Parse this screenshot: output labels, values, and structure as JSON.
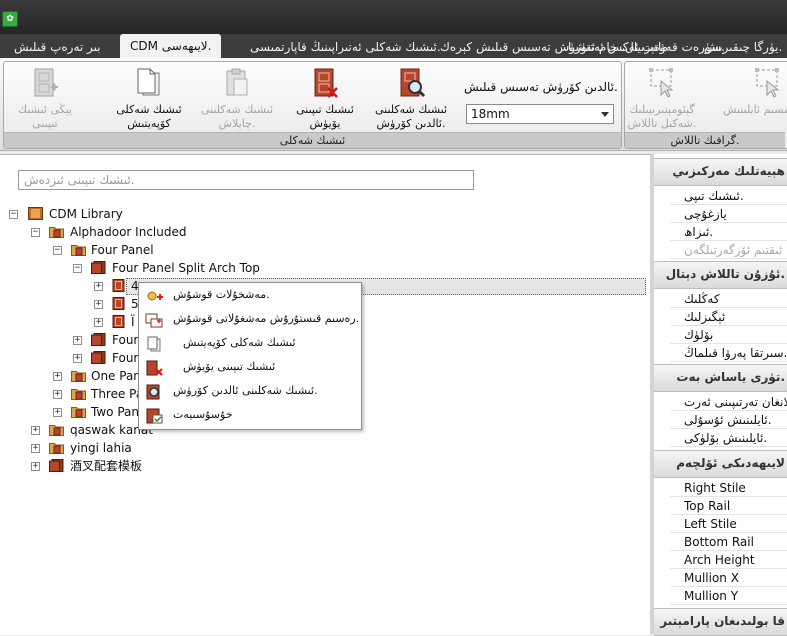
{
  "tabs": [
    {
      "label": "بىر تەرەپ قىلىش"
    },
    {
      "label": "CDM لايىھەسى."
    },
    {
      "label": "ئىشىك شەكلى ئەتىراپىنىڭ قاپارتمىسى."
    },
    {
      "label": "سۈرەت قەۋەت ئەكس ئەتتۈرۈش تەسىس قىلىش كېرەك."
    },
    {
      "label": "ماتېرىيال، خام ئەشيا"
    },
    {
      "label": "يۈرگا چىقىرىش."
    }
  ],
  "ribbon": {
    "door_group_caption": "ئىشىك شەكلى",
    "graphic_group_caption": "گرافىك تاللاش.",
    "thickness_label": "ئالدىن كۆرۈش تەسىس قىلىش.",
    "thickness_value": "18mm",
    "buttons": {
      "preview": "ئىشىك شەكلىنى ئالدىن كۆرۈش.",
      "delete": "ئىشىك تىپىنى يۆيۈش",
      "paste": "ئىشىك شەكلىنى چاپلاش.",
      "copy": "ئىشىك شەكلى كۆپەيتىش",
      "new": "يېڭى ئىشىك تىپىنى كۆپەيتىش.",
      "geometry": "گېئومېتىرىيىلىك شەكىل تاللاش.",
      "group": "بۆلەك تاللاش.",
      "partition": "قىسىم ئايلىنىش."
    }
  },
  "search": {
    "placeholder": "ئىشىك تىپىنى ئىزدەش."
  },
  "tree": {
    "root": "CDM Library",
    "alphadoor": "Alphadoor Included",
    "four_panel": "Four Panel",
    "split_arch": "Four Panel Split Arch Top",
    "child1": "4",
    "child2": "5",
    "child3": "Ï",
    "four_a": "Four",
    "four_b": "Four",
    "one_panel": "One Pan",
    "three_panel": "Three Pa",
    "two_panel": "Two Pan",
    "qaswak": "qaswak kanat",
    "yingi": "yingi lahia",
    "cn": "酒叉配套模板"
  },
  "context_menu": [
    {
      "label": "مەشخۇلات قوشۇش."
    },
    {
      "label": "رەسىم قىستۇرۇش مەشغۇلاتى قوشۇش."
    },
    {
      "label": "ئىشىك شەكلى كۆپەيتىش"
    },
    {
      "label": "ئىشىك تىپىنى يۆيۈش"
    },
    {
      "label": "ئىشىك شەكلىنى ئالدىن كۆرۈش."
    },
    {
      "label": "خۇسۇسىيەت"
    }
  ],
  "props": {
    "sec1_title": "ھېيەتلىك مەركىزىي",
    "sec1_rows": [
      {
        "label": "ئىشىك تىپى."
      },
      {
        "label": "يازغۇچى"
      },
      {
        "label": "ئىزاھ."
      },
      {
        "label": "ئىقتىم ئۆزگەرتىلگەن"
      }
    ],
    "sec2_title": "ئۇزۇن تاللاش دېتال.",
    "sec2_rows": [
      {
        "label": "كەڭلىك"
      },
      {
        "label": "ئېگىزلىك"
      },
      {
        "label": "بۆلۈك"
      },
      {
        "label": "سىرتقا پەرۋا قىلماڭ."
      }
    ],
    "sec3_title": "تۈرى ياساش بەت.",
    "sec3_rows": [
      {
        "label": "تاللانغان تەرتىپىنى ئەرت."
      },
      {
        "label": "ئايلىنىش ئۇسۇلى."
      },
      {
        "label": "ئايلىنىش بۆلۈكى."
      }
    ],
    "sec4_title": "لايىھەدىكى ئۆلچەم",
    "sec4_rows": [
      {
        "label": "Right Stile"
      },
      {
        "label": "Top Rail"
      },
      {
        "label": "Left Stile"
      },
      {
        "label": "Bottom Rail"
      },
      {
        "label": "Arch Height"
      },
      {
        "label": "Mullion X"
      },
      {
        "label": "Mullion Y"
      }
    ],
    "sec5_title": "قا بولىدىغان پارامېتىر"
  }
}
